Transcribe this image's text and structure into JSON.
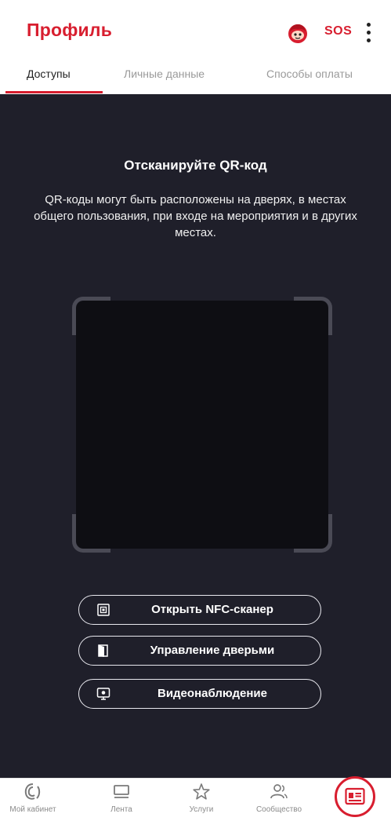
{
  "header": {
    "title": "Профиль",
    "sos_label": "SOS",
    "mascot_icon": "mascot-icon",
    "menu_icon": "kebab-menu-icon"
  },
  "tabs": [
    {
      "label": "Доступы",
      "active": true
    },
    {
      "label": "Личные данные",
      "active": false
    },
    {
      "label": "Способы оплаты",
      "active": false
    }
  ],
  "scanner": {
    "title": "Отсканируйте QR-код",
    "description": "QR-коды могут быть расположены на дверях, в местах общего пользования, при входе на мероприятия и в других местах."
  },
  "actions": [
    {
      "label": "Открыть NFC-сканер",
      "icon": "nfc-icon"
    },
    {
      "label": "Управление дверьми",
      "icon": "door-icon"
    },
    {
      "label": "Видеонаблюдение",
      "icon": "video-monitor-icon"
    }
  ],
  "bottom_nav": [
    {
      "label": "Мой кабинет",
      "icon": "cabinet-logo-icon"
    },
    {
      "label": "Лента",
      "icon": "feed-icon"
    },
    {
      "label": "Услуги",
      "icon": "star-icon"
    },
    {
      "label": "Сообщество",
      "icon": "community-icon"
    }
  ],
  "fab_icon": "id-card-icon",
  "colors": {
    "brand": "#d81e2f",
    "scanner_bg": "#1f1f2a",
    "viewfinder_bg": "#0e0e13"
  }
}
